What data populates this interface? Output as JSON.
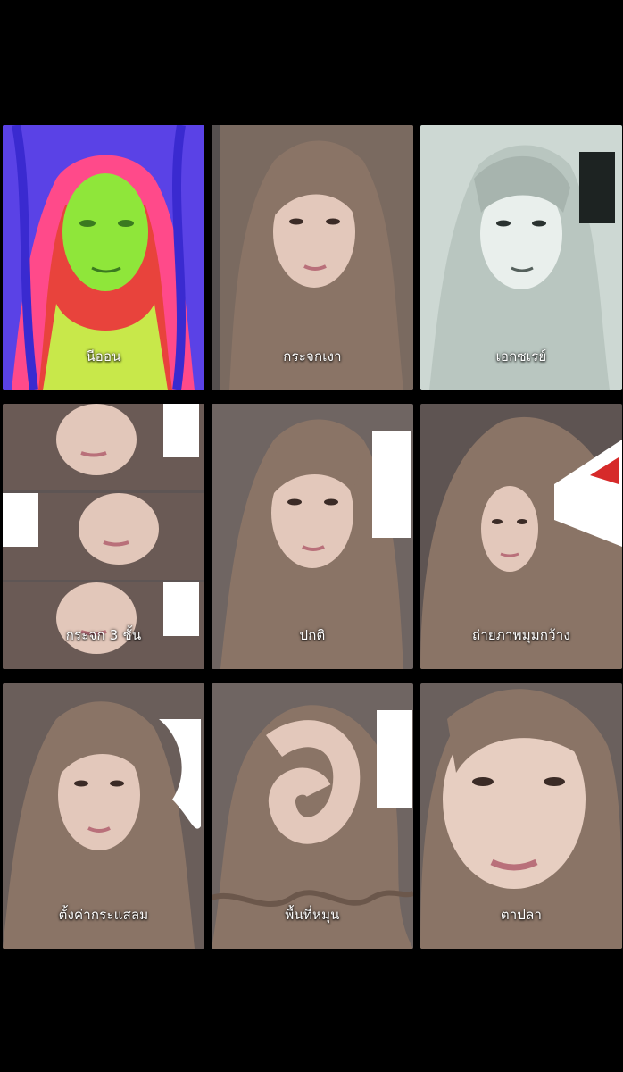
{
  "filters": [
    {
      "id": "neon",
      "label": "นีออน"
    },
    {
      "id": "mirror",
      "label": "กระจกเงา"
    },
    {
      "id": "xray",
      "label": "เอกซเรย์"
    },
    {
      "id": "triple-mirror",
      "label": "กระจก 3 ชั้น"
    },
    {
      "id": "normal",
      "label": "ปกติ"
    },
    {
      "id": "wide-angle",
      "label": "ถ่ายภาพมุมกว้าง"
    },
    {
      "id": "current",
      "label": "ตั้งค่ากระแสลม"
    },
    {
      "id": "swirl",
      "label": "พื้นที่หมุน"
    },
    {
      "id": "fisheye",
      "label": "ตาปลา"
    }
  ],
  "colors": {
    "background": "#000000",
    "hair": "#8a7466",
    "skin": "#e8cfc2",
    "neon_purple": "#5a3ee0",
    "neon_green": "#8ee83a",
    "neon_red": "#ff3a5a",
    "xray_bg": "#cfd8d4"
  }
}
